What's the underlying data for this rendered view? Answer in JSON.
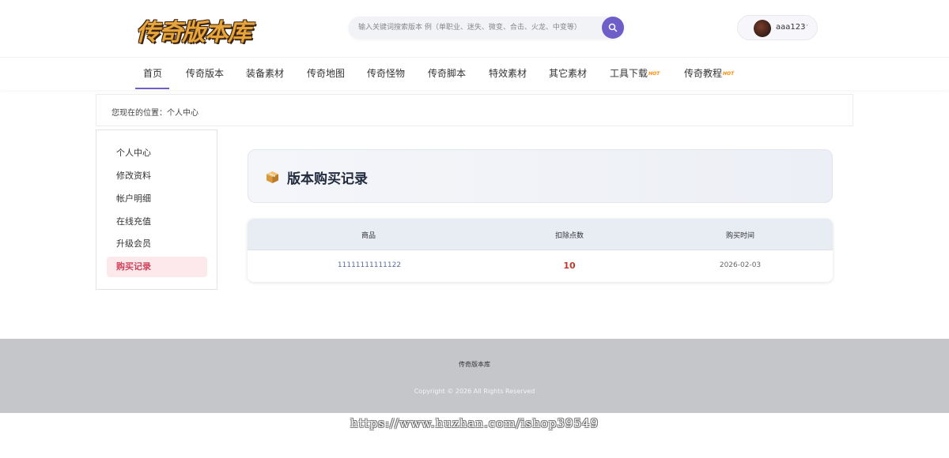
{
  "header": {
    "logo_text": "传奇版本库",
    "search": {
      "placeholder": "输入关键词搜索版本 例（单职业、迷失、微变、合击、火龙、中变等）"
    },
    "user": {
      "name": "aaa123",
      "menu_indicator": "·"
    }
  },
  "nav": {
    "items": [
      {
        "label": "首页",
        "hot": ""
      },
      {
        "label": "传奇版本",
        "hot": ""
      },
      {
        "label": "装备素材",
        "hot": ""
      },
      {
        "label": "传奇地图",
        "hot": ""
      },
      {
        "label": "传奇怪物",
        "hot": ""
      },
      {
        "label": "传奇脚本",
        "hot": ""
      },
      {
        "label": "特效素材",
        "hot": ""
      },
      {
        "label": "其它素材",
        "hot": ""
      },
      {
        "label": "工具下载",
        "hot": "HOT"
      },
      {
        "label": "传奇教程",
        "hot": "HOT"
      }
    ],
    "active_index": 0
  },
  "breadcrumb": {
    "text": "您现在的位置：个人中心"
  },
  "sidebar": {
    "items": [
      {
        "label": "个人中心"
      },
      {
        "label": "修改资料"
      },
      {
        "label": "帐户明细"
      },
      {
        "label": "在线充值"
      },
      {
        "label": "升级会员"
      },
      {
        "label": "购买记录"
      }
    ],
    "active_index": 5
  },
  "main": {
    "title": "版本购买记录",
    "title_icon": "package-icon",
    "table": {
      "headers": [
        "商品",
        "扣除点数",
        "购买时间"
      ],
      "rows": [
        {
          "product": "11111111111122",
          "points": "10",
          "date": "2026-02-03"
        }
      ]
    }
  },
  "footer": {
    "title": "传奇版本库",
    "copyright": "Copyright © 2026 All Rights Reserved"
  },
  "watermark": "https://www.huzhan.com/ishop39549",
  "colors": {
    "accent": "#6d5fc7",
    "active_side_bg": "#fde8ec",
    "active_side_text": "#d0435b",
    "points": "#c0392b",
    "footer_bg": "#c4c6ca"
  }
}
